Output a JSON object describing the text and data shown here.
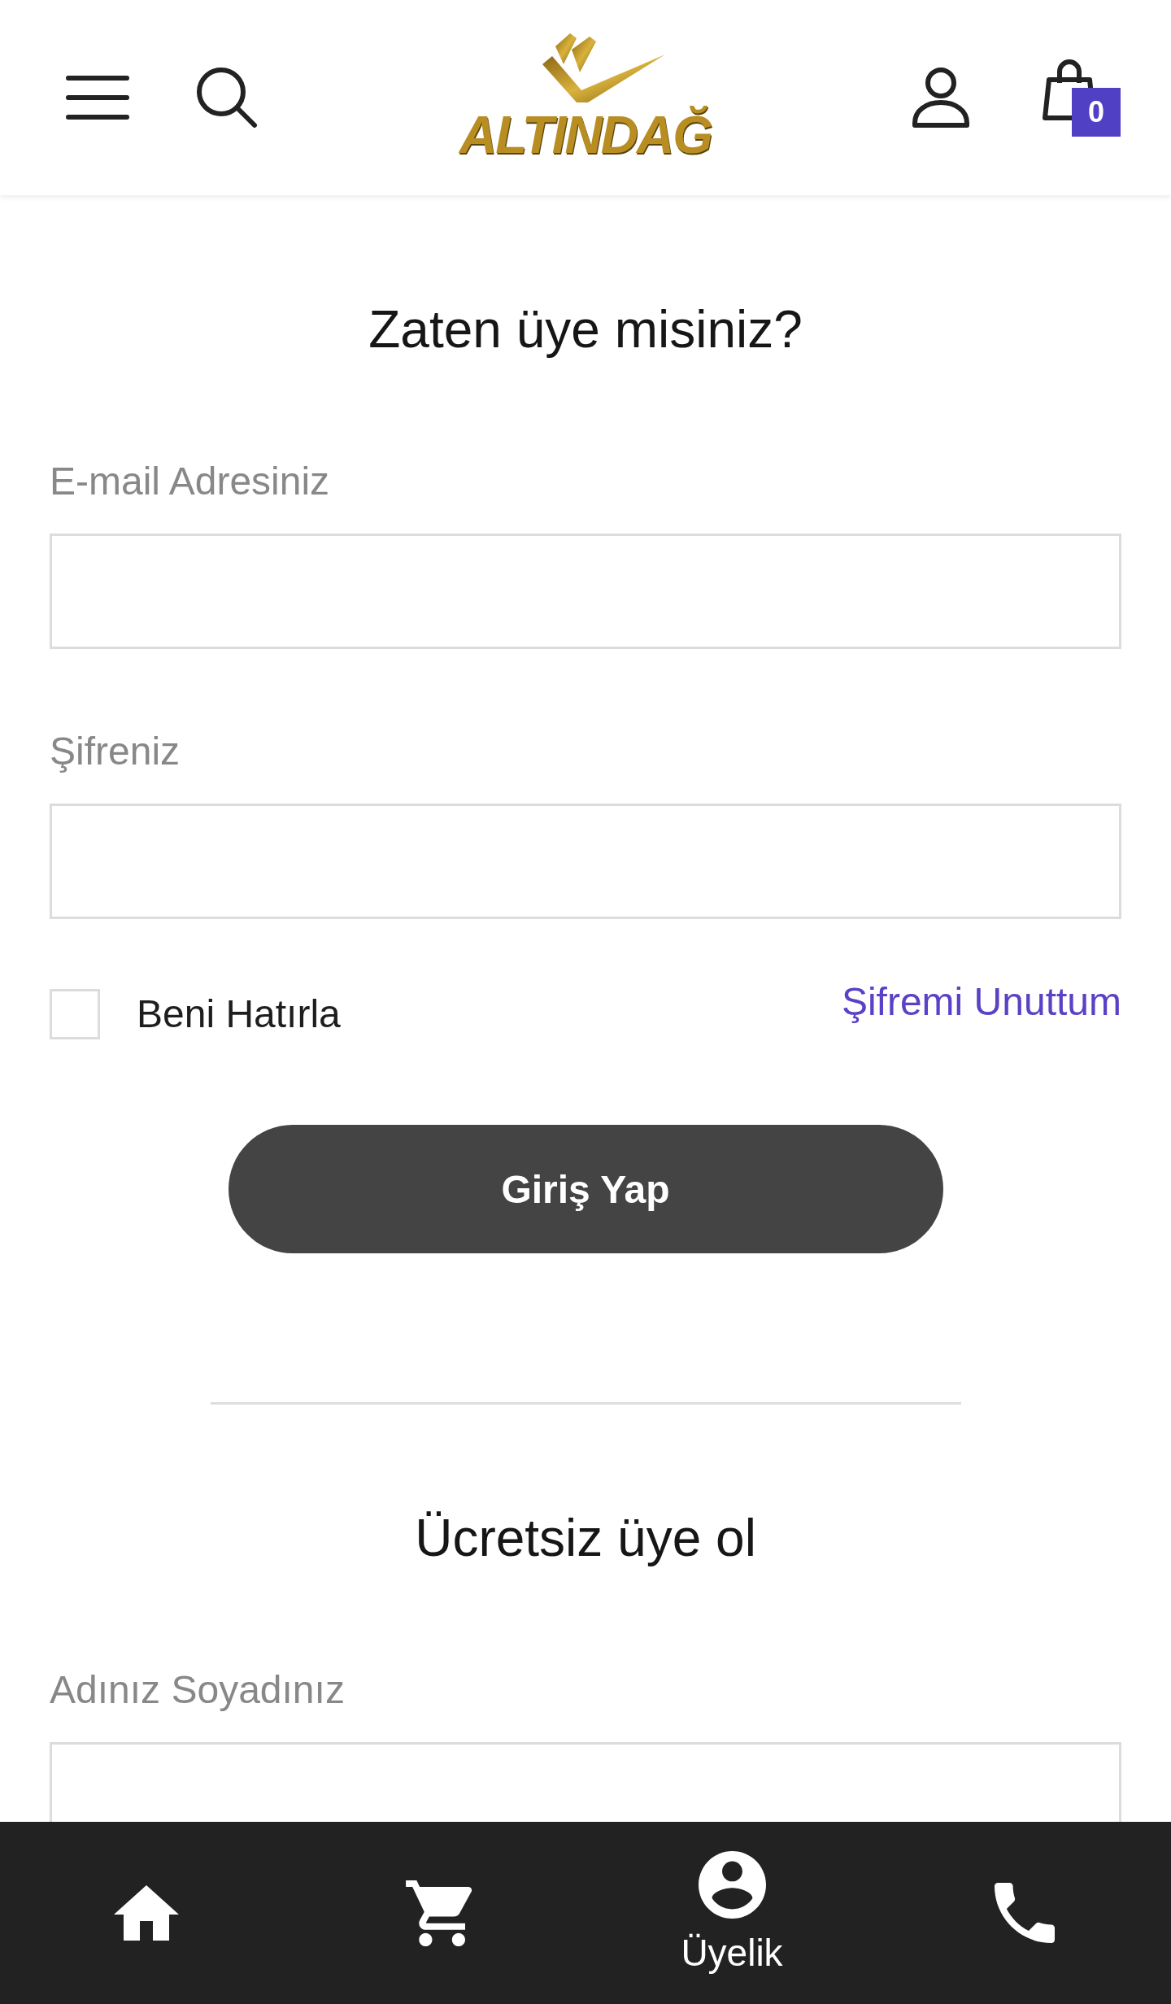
{
  "header": {
    "logo": {
      "text": "ALTINDAĞ"
    },
    "cart": {
      "count": "0"
    }
  },
  "login": {
    "title": "Zaten üye misiniz?",
    "fields": [
      {
        "label": "E-mail Adresiniz"
      },
      {
        "label": "Şifreniz"
      }
    ],
    "remember": {
      "label": "Beni Hatırla",
      "checked": false
    },
    "forgot_link": "Şifremi Unuttum",
    "submit": "Giriş Yap"
  },
  "signup": {
    "title": "Ücretsiz üye ol",
    "fields": [
      {
        "label": "Adınız Soyadınız"
      }
    ]
  },
  "bottom_nav": [
    {
      "kind": "home"
    },
    {
      "kind": "cart"
    },
    {
      "kind": "account",
      "label": "Üyelik"
    },
    {
      "kind": "phone"
    }
  ]
}
